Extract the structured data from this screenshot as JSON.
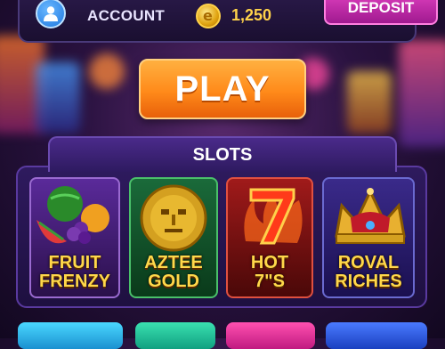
{
  "header": {
    "account_label": "ACCOUNT",
    "balance": "1,250",
    "deposit_label": "DEPOSIT",
    "icons": [
      "user-avatar-icon",
      "coin-icon"
    ]
  },
  "play_label": "PLAY",
  "slots": {
    "title": "SLOTS",
    "games": [
      {
        "line1": "FRUIT",
        "line2": "FRENZY"
      },
      {
        "line1": "AZTEE",
        "line2": "GOLD"
      },
      {
        "line1": "HOT",
        "line2": "7\"S"
      },
      {
        "line1": "ROVAL",
        "line2": "RICHES"
      }
    ]
  },
  "colors": {
    "accent_play": "#ff8a1a",
    "accent_deposit": "#c02aa8",
    "coin_gold": "#ffd24a"
  }
}
